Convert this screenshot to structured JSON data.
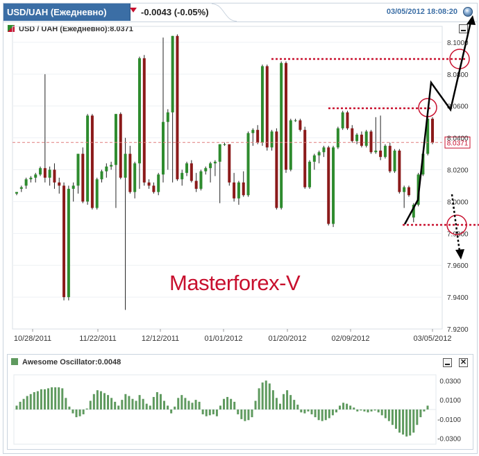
{
  "header": {
    "symbol_tab": "USD/UAH (Ежедневно)",
    "change": "-0.0043 (-0.05%)",
    "datetime": "03/05/2012 18:08:20"
  },
  "watermark": "Masterforex-V",
  "colors": {
    "up": "#2e8b2e",
    "down": "#8b1a1a",
    "accent": "#3b6ea5",
    "annotation": "#c8102e",
    "oscillator": "#5f9a5f"
  },
  "icons": {
    "dropdown": "chevron-down-icon",
    "globe": "globe-icon",
    "minimize": "minimize-icon",
    "close": "close-icon"
  },
  "chart_data": [
    {
      "type": "candlestick",
      "title": "USD / UAH (Ежедневно):8.0371",
      "last_value": "8.0371",
      "ylim": [
        7.92,
        8.11
      ],
      "y_ticks": [
        "8.1000",
        "8.0800",
        "8.0600",
        "8.0400",
        "8.0200",
        "8.0000",
        "7.9800",
        "7.9600",
        "7.9400",
        "7.9200"
      ],
      "x_ticks": [
        "10/28/2011",
        "11/22/2011",
        "12/12/2011",
        "01/01/2012",
        "01/20/2012",
        "02/09/2012",
        "03/05/2012"
      ],
      "candles": [
        [
          8.005,
          8.006,
          8.004,
          8.006
        ],
        [
          8.008,
          8.01,
          8.006,
          8.009
        ],
        [
          8.01,
          8.015,
          8.008,
          8.014
        ],
        [
          8.014,
          8.016,
          8.012,
          8.015
        ],
        [
          8.015,
          8.018,
          8.012,
          8.017
        ],
        [
          8.017,
          8.022,
          8.016,
          8.021
        ],
        [
          8.021,
          8.08,
          8.012,
          8.015
        ],
        [
          8.015,
          8.022,
          8.01,
          8.02
        ],
        [
          8.02,
          8.024,
          8.008,
          8.012
        ],
        [
          8.012,
          8.015,
          8.005,
          8.01
        ],
        [
          8.01,
          8.012,
          7.938,
          7.94
        ],
        [
          7.94,
          8.01,
          7.938,
          8.008
        ],
        [
          8.008,
          8.012,
          8.0,
          8.01
        ],
        [
          8.01,
          8.03,
          8.005,
          8.03
        ],
        [
          8.03,
          8.034,
          7.999,
          8.0
        ],
        [
          8.0,
          8.055,
          7.998,
          8.054
        ],
        [
          8.054,
          8.055,
          7.995,
          7.996
        ],
        [
          7.996,
          8.015,
          7.995,
          8.014
        ],
        [
          8.014,
          8.02,
          8.012,
          8.019
        ],
        [
          8.019,
          8.024,
          8.015,
          8.022
        ],
        [
          8.022,
          8.025,
          8.02,
          8.023
        ],
        [
          8.023,
          8.055,
          7.996,
          8.055
        ],
        [
          8.055,
          8.056,
          8.014,
          8.015
        ],
        [
          8.015,
          8.04,
          7.932,
          8.03
        ],
        [
          8.03,
          8.035,
          8.005,
          8.006
        ],
        [
          8.006,
          8.025,
          8.002,
          8.024
        ],
        [
          8.024,
          8.091,
          8.008,
          8.09
        ],
        [
          8.09,
          8.092,
          8.01,
          8.012
        ],
        [
          8.012,
          8.014,
          8.008,
          8.01
        ],
        [
          8.01,
          8.012,
          8.005,
          8.006
        ],
        [
          8.006,
          8.018,
          8.004,
          8.017
        ],
        [
          8.017,
          8.103,
          8.012,
          8.05
        ],
        [
          8.05,
          8.058,
          8.02,
          8.056
        ],
        [
          8.056,
          8.104,
          8.012,
          8.104
        ],
        [
          8.104,
          8.105,
          8.013,
          8.014
        ],
        [
          8.014,
          8.02,
          8.01,
          8.018
        ],
        [
          8.018,
          8.025,
          8.016,
          8.024
        ],
        [
          8.024,
          8.026,
          8.012,
          8.013
        ],
        [
          8.013,
          8.018,
          8.006,
          8.008
        ],
        [
          8.008,
          8.02,
          8.007,
          8.019
        ],
        [
          8.019,
          8.022,
          8.017,
          8.021
        ],
        [
          8.021,
          8.025,
          8.012,
          8.024
        ],
        [
          8.024,
          8.026,
          8.016,
          8.025
        ],
        [
          8.025,
          8.036,
          7.999,
          8.036
        ],
        [
          8.036,
          8.037,
          8.035,
          8.036
        ],
        [
          8.036,
          8.034,
          8.01,
          8.012
        ],
        [
          8.012,
          8.018,
          8.0,
          8.002
        ],
        [
          8.002,
          8.013,
          7.998,
          8.012
        ],
        [
          8.012,
          8.019,
          8.003,
          8.004
        ],
        [
          8.004,
          8.044,
          8.003,
          8.043
        ],
        [
          8.043,
          8.046,
          8.035,
          8.045
        ],
        [
          8.045,
          8.048,
          8.036,
          8.037
        ],
        [
          8.037,
          8.086,
          8.035,
          8.085
        ],
        [
          8.085,
          8.086,
          8.032,
          8.034
        ],
        [
          8.034,
          8.045,
          8.032,
          8.044
        ],
        [
          8.044,
          8.046,
          7.995,
          7.996
        ],
        [
          7.996,
          8.088,
          7.995,
          8.087
        ],
        [
          8.087,
          8.088,
          8.018,
          8.02
        ],
        [
          8.02,
          8.052,
          8.019,
          8.051
        ],
        [
          8.051,
          8.052,
          8.05,
          8.051
        ],
        [
          8.051,
          8.052,
          8.044,
          8.045
        ],
        [
          8.045,
          8.047,
          8.008,
          8.009
        ],
        [
          8.009,
          8.026,
          8.008,
          8.025
        ],
        [
          8.025,
          8.03,
          8.02,
          8.029
        ],
        [
          8.029,
          8.032,
          8.024,
          8.031
        ],
        [
          8.031,
          8.035,
          8.028,
          8.034
        ],
        [
          8.034,
          8.035,
          7.985,
          7.986
        ],
        [
          7.986,
          8.035,
          7.984,
          8.034
        ],
        [
          8.034,
          8.047,
          8.033,
          8.046
        ],
        [
          8.046,
          8.057,
          8.045,
          8.056
        ],
        [
          8.056,
          8.057,
          8.045,
          8.046
        ],
        [
          8.046,
          8.048,
          8.037,
          8.038
        ],
        [
          8.038,
          8.043,
          8.036,
          8.042
        ],
        [
          8.042,
          8.044,
          8.034,
          8.035
        ],
        [
          8.035,
          8.045,
          8.034,
          8.044
        ],
        [
          8.044,
          8.045,
          8.03,
          8.031
        ],
        [
          8.031,
          8.053,
          8.03,
          8.032
        ],
        [
          8.032,
          8.054,
          8.026,
          8.028
        ],
        [
          8.028,
          8.036,
          8.027,
          8.035
        ],
        [
          8.035,
          8.037,
          8.018,
          8.019
        ],
        [
          8.019,
          8.033,
          8.018,
          8.032
        ],
        [
          8.032,
          8.033,
          8.005,
          8.006
        ],
        [
          8.006,
          8.01,
          7.996,
          8.009
        ],
        [
          8.009,
          8.01,
          8.003,
          8.004
        ],
        [
          7.99,
          7.999,
          7.987,
          7.998
        ],
        [
          7.998,
          8.018,
          7.997,
          8.017
        ],
        [
          8.017,
          8.031,
          8.016,
          8.03
        ],
        [
          8.03,
          8.054,
          8.029,
          8.052
        ],
        [
          8.052,
          8.053,
          8.036,
          8.037
        ]
      ]
    },
    {
      "type": "bar",
      "title": "Awesome Oscillator:0.0048",
      "ylim": [
        -0.036,
        0.036
      ],
      "y_ticks": [
        "0.0300",
        "0.0100",
        "-0.0100",
        "-0.0300"
      ],
      "values": [
        0.004,
        0.008,
        0.011,
        0.014,
        0.016,
        0.018,
        0.019,
        0.021,
        0.021,
        0.022,
        0.023,
        0.023,
        0.023,
        0.022,
        0.012,
        0.003,
        -0.004,
        -0.008,
        -0.007,
        -0.005,
        0.001,
        0.009,
        0.016,
        0.02,
        0.019,
        0.017,
        0.015,
        0.012,
        0.008,
        0.004,
        0.01,
        0.016,
        0.014,
        0.011,
        0.009,
        0.015,
        0.011,
        0.006,
        0.004,
        0.013,
        0.018,
        0.016,
        0.009,
        0.004,
        -0.004,
        0.003,
        0.012,
        0.015,
        0.012,
        0.009,
        0.007,
        0.01,
        0.008,
        -0.005,
        -0.007,
        -0.006,
        -0.005,
        -0.007,
        0.004,
        0.011,
        0.013,
        0.011,
        0.008,
        -0.005,
        -0.01,
        -0.012,
        -0.011,
        -0.008,
        0.009,
        0.022,
        0.028,
        0.03,
        0.027,
        0.02,
        0.012,
        0.006,
        0.016,
        0.02,
        0.015,
        0.01,
        0.005,
        -0.003,
        -0.004,
        -0.002,
        -0.005,
        -0.008,
        -0.011,
        -0.012,
        -0.011,
        -0.009,
        -0.006,
        -0.003,
        0.004,
        0.007,
        0.006,
        0.004,
        0.002,
        -0.002,
        -0.001,
        -0.002,
        -0.003,
        -0.002,
        -0.001,
        -0.003,
        -0.006,
        -0.009,
        -0.012,
        -0.016,
        -0.02,
        -0.024,
        -0.026,
        -0.028,
        -0.027,
        -0.024,
        -0.016,
        -0.008,
        -0.002,
        0.004
      ]
    }
  ]
}
